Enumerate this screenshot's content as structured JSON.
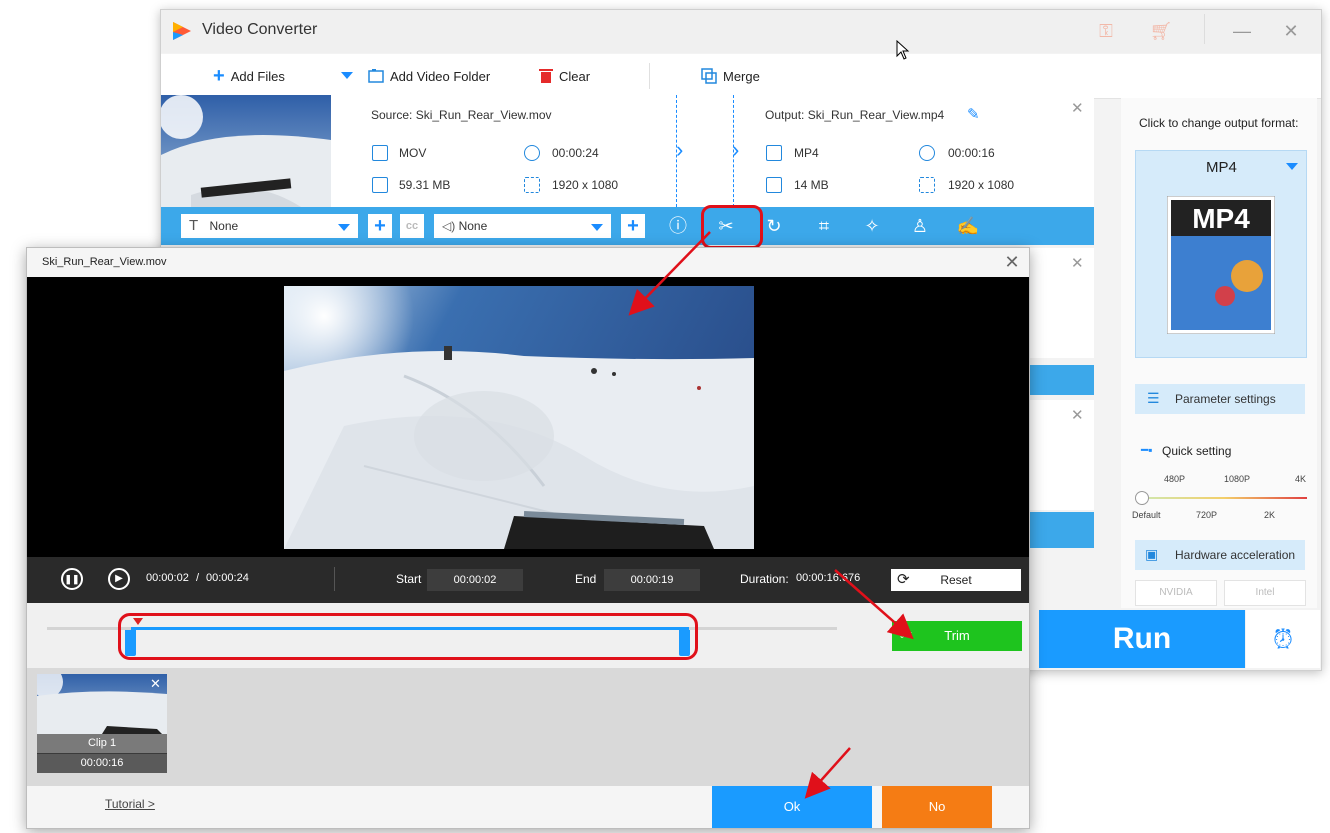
{
  "app": {
    "title": "Video Converter"
  },
  "toolbar": {
    "add_files": "Add Files",
    "add_folder": "Add Video Folder",
    "clear": "Clear",
    "merge": "Merge"
  },
  "file": {
    "source_label": "Source: Ski_Run_Rear_View.mov",
    "output_label": "Output: Ski_Run_Rear_View.mp4",
    "src_format": "MOV",
    "src_duration": "00:00:24",
    "src_size": "59.31 MB",
    "src_resolution": "1920 x 1080",
    "out_format": "MP4",
    "out_duration": "00:00:16",
    "out_size": "14 MB",
    "out_resolution": "1920 x 1080"
  },
  "edit_bar": {
    "subtitle_value": "None",
    "audio_value": "None"
  },
  "side": {
    "output_format_label": "Click to change output format:",
    "format": "MP4",
    "format_art_text": "MP4",
    "parameter_settings": "Parameter settings",
    "quick_setting": "Quick setting",
    "quality_top": [
      "480P",
      "1080P",
      "4K"
    ],
    "quality_bottom": [
      "Default",
      "720P",
      "2K"
    ],
    "hardware_accel": "Hardware acceleration",
    "gpu_nvidia": "NVIDIA",
    "gpu_intel": "Intel",
    "run": "Run"
  },
  "dialog": {
    "title": "Ski_Run_Rear_View.mov",
    "current_time": "00:00:02",
    "time_separator": "/",
    "total_time": "00:00:24",
    "start_label": "Start",
    "start_value": "00:00:02",
    "end_label": "End",
    "end_value": "00:00:19",
    "duration_label": "Duration:",
    "duration_value": "00:00:16.676",
    "reset": "Reset",
    "trim": "Trim",
    "clip_name": "Clip 1",
    "clip_duration": "00:00:16",
    "tutorial": "Tutorial >",
    "ok": "Ok",
    "no": "No"
  },
  "colors": {
    "accent": "#1a9bff",
    "edit_bar": "#3ca8ea",
    "trim_green": "#1ec41e",
    "no_orange": "#f57c14",
    "annotation_red": "#e0101a"
  }
}
